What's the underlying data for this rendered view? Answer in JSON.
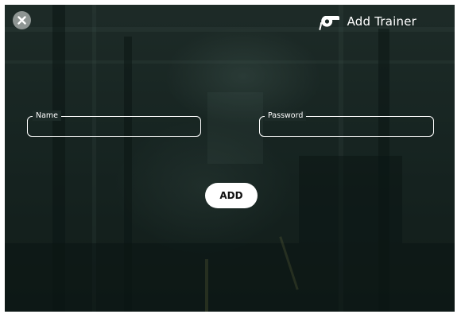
{
  "header": {
    "title": "Add Trainer",
    "icon": "whistle-icon"
  },
  "close_button": {
    "icon": "close-icon"
  },
  "form": {
    "name_label": "Name",
    "name_value": "",
    "password_label": "Password",
    "password_value": "",
    "submit_label": "ADD"
  },
  "colors": {
    "overlay": "#1c2a27",
    "text": "#ffffff",
    "button_bg": "#ffffff",
    "button_text": "#111111",
    "close_bg": "#8e9593"
  }
}
